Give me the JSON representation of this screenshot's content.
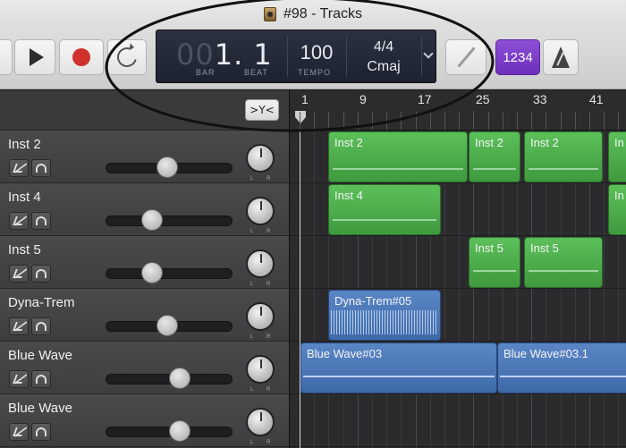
{
  "window": {
    "title": "#98 - Tracks"
  },
  "lcd": {
    "bar_prefix": "00",
    "bar": "1",
    "beat": ". 1",
    "bar_label": "BAR",
    "beat_label": "BEAT",
    "tempo": "100",
    "tempo_label": "TEMPO",
    "time_signature": "4/4",
    "key": "Cmaj"
  },
  "toolbar": {
    "count_in_label": "1234"
  },
  "catch_button": {
    "label": ">Y<"
  },
  "ruler": {
    "labels": [
      "1",
      "9",
      "17",
      "25",
      "33",
      "41"
    ]
  },
  "tracks": [
    {
      "name": "Inst 2",
      "volume": 0.48
    },
    {
      "name": "Inst 4",
      "volume": 0.34
    },
    {
      "name": "Inst 5",
      "volume": 0.34
    },
    {
      "name": "Dyna-Trem",
      "volume": 0.48
    },
    {
      "name": "Blue Wave",
      "volume": 0.6
    },
    {
      "name": "Blue Wave",
      "volume": 0.6
    }
  ],
  "pan_labels": {
    "left": "L",
    "right": "R"
  },
  "regions": {
    "inst2_a": "Inst 2",
    "inst2_b": "Inst 2",
    "inst2_c": "Inst 2",
    "inst2_d": "In",
    "inst4_a": "Inst 4",
    "inst4_b": "In",
    "inst5_a": "Inst 5",
    "inst5_b": "Inst 5",
    "dyna_a": "Dyna-Trem#05",
    "blue_a": "Blue Wave#03",
    "blue_b": "Blue Wave#03.1"
  },
  "colors": {
    "midi_region": "#4fae4d",
    "audio_region": "#4a76b8",
    "count_in": "#7d3fc8",
    "record": "#d0312d"
  }
}
